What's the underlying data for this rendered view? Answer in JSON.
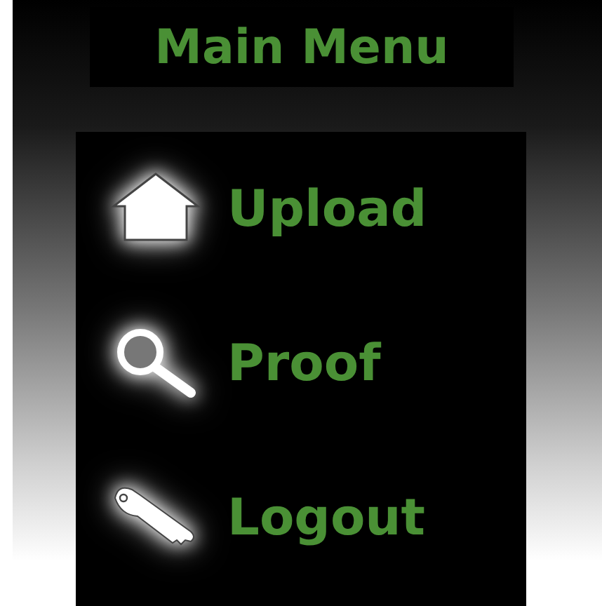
{
  "title": "Main Menu",
  "menu": [
    {
      "label": "Upload",
      "kind": "house"
    },
    {
      "label": "Proof",
      "kind": "magnifier"
    },
    {
      "label": "Logout",
      "kind": "key"
    }
  ]
}
